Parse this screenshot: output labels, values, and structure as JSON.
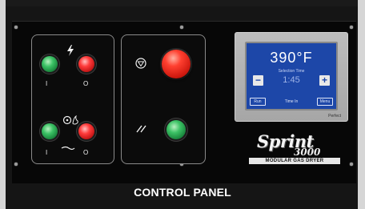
{
  "panel": {
    "title": "CONTROL PANEL",
    "colors": {
      "frame": "#151515",
      "panel": "#070707",
      "start_green": "#2fb55a",
      "stop_red": "#e01b1b",
      "screen_blue": "#1d47a8"
    }
  },
  "power_group": {
    "icon": "lightning-icon",
    "on_label": "I",
    "off_label": "O"
  },
  "burner_group": {
    "icon": "fan-flame-icon",
    "on_label": "I",
    "off_label": "O"
  },
  "emergency_group": {
    "stop_icon": "emergency-stop-icon",
    "reset_icon": "reset-icon"
  },
  "display": {
    "temperature": "390°F",
    "selection_label": "Selection Time",
    "time_value": "1:45",
    "minus_label": "−",
    "plus_label": "+",
    "left_button": "Run",
    "center_text": "Time In",
    "right_button": "Menu",
    "bezel_brand": "Perfect"
  },
  "branding": {
    "product_name": "Sprint",
    "model_number": "3000",
    "tagline": "MODULAR GAS DRYER"
  }
}
